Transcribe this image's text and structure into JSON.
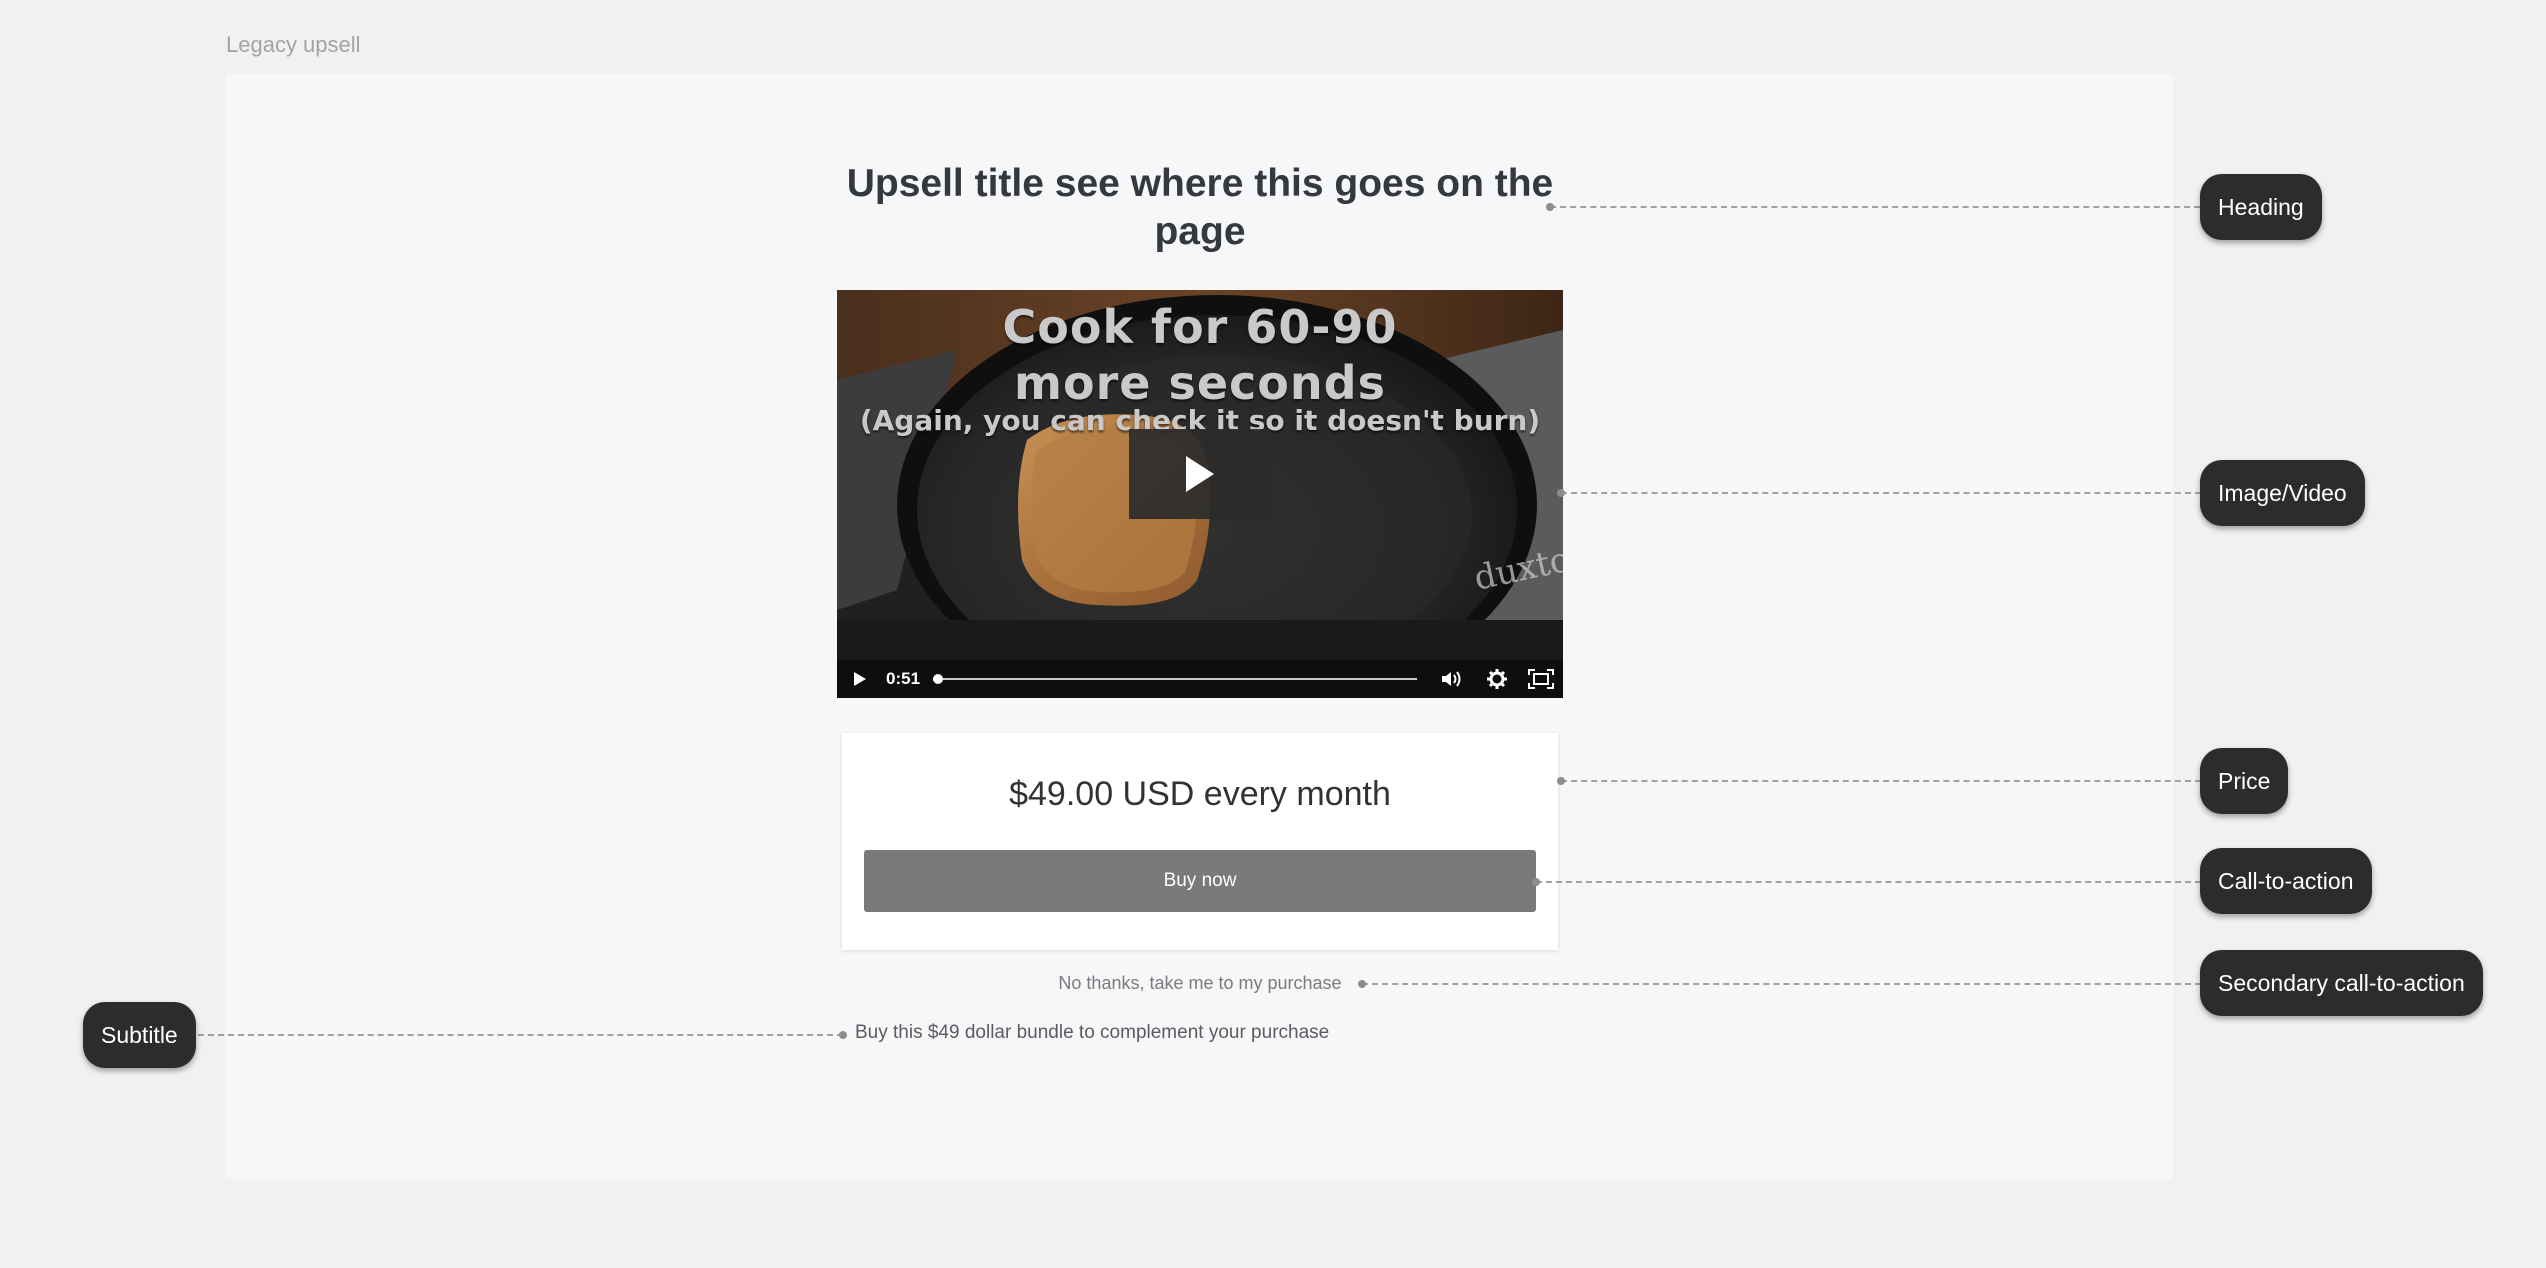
{
  "frame": {
    "label": "Legacy upsell"
  },
  "upsell": {
    "heading": "Upsell title see where this goes on the page",
    "video": {
      "overlay_line1": "Cook for 60-90",
      "overlay_line2": "more seconds",
      "overlay_line3": "(Again, you can check it so it doesn't burn)",
      "time": "0:51",
      "progress": 0.01
    },
    "price": "$49.00 USD every month",
    "buy_button": "Buy now",
    "secondary_cta": "No thanks, take me to my purchase",
    "subtitle": "Buy this $49 dollar bundle to complement your purchase"
  },
  "annotations": {
    "heading": "Heading",
    "image_video": "Image/Video",
    "price": "Price",
    "cta": "Call-to-action",
    "secondary_cta": "Secondary call-to-action",
    "subtitle": "Subtitle"
  },
  "colors": {
    "page_bg": "#f1f1f1",
    "canvas_bg": "#f6f7f9",
    "button_bg": "#7a7a7a",
    "annotation_pill": "#2c2c2c"
  }
}
